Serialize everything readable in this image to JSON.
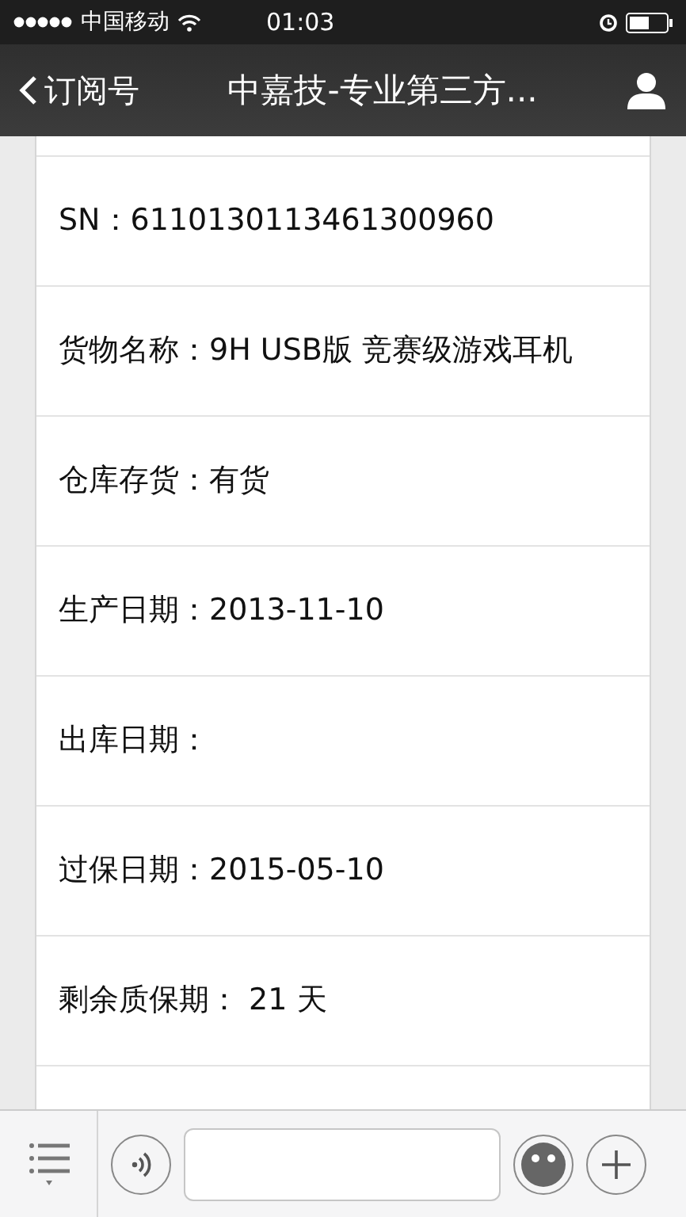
{
  "status_bar": {
    "carrier": "中国移动",
    "time": "01:03"
  },
  "nav_bar": {
    "back_label": "订阅号",
    "title": "中嘉技-专业第三方..."
  },
  "rows": [
    {
      "text": "SN：6110130113461300960"
    },
    {
      "text": "货物名称：9H USB版 竞赛级游戏耳机"
    },
    {
      "text": "仓库存货：有货"
    },
    {
      "text": "生产日期：2013-11-10"
    },
    {
      "text": "出库日期："
    },
    {
      "text": "过保日期：2015-05-10"
    },
    {
      "text": "剩余质保期： 21 天"
    }
  ]
}
